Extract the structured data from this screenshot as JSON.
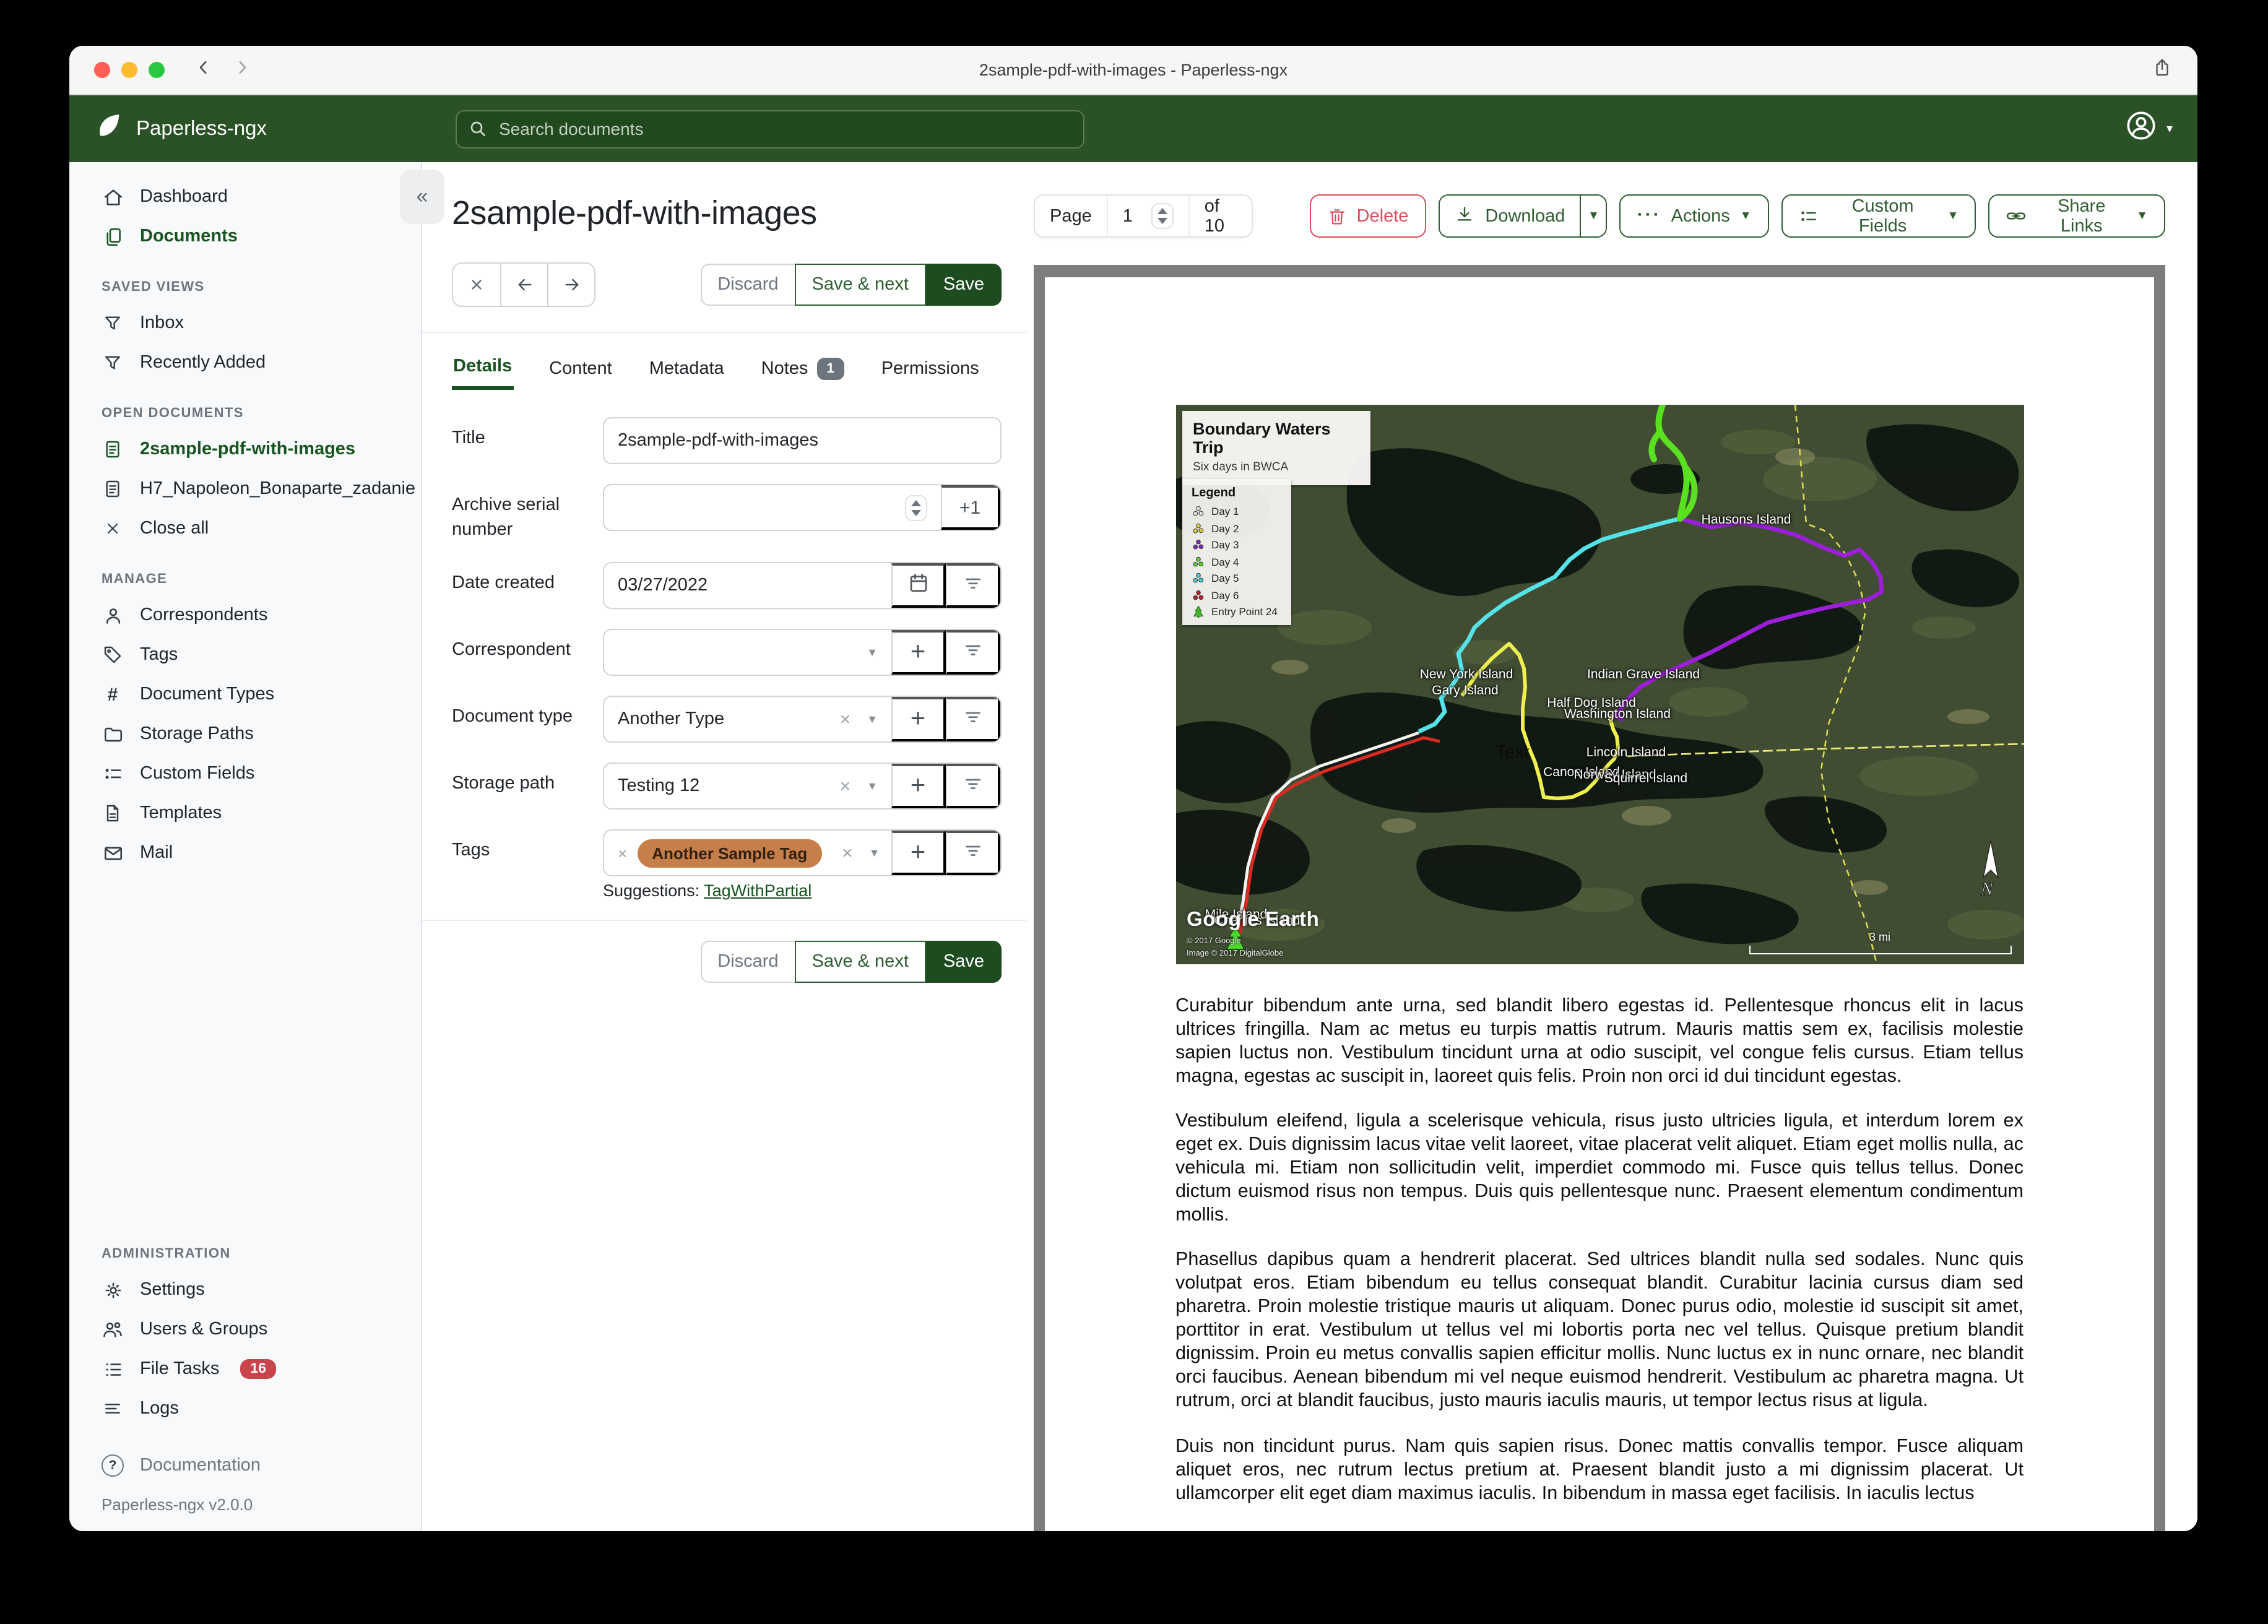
{
  "colors": {
    "header_green": "#2a5226",
    "primary_green": "#2f5e31",
    "active_green": "#17541f",
    "save_green": "#1e4c21",
    "delete_red": "#dc4c5c",
    "badge_red": "#c9444d",
    "tag_orange": "#c67e4a",
    "traffic_red": "#ff5f57",
    "traffic_yellow": "#febc2e",
    "traffic_green": "#28c840"
  },
  "window": {
    "title": "2sample-pdf-with-images - Paperless-ngx"
  },
  "header": {
    "app_name": "Paperless-ngx",
    "search_placeholder": "Search documents"
  },
  "sidebar": {
    "sections": {
      "saved_views": "SAVED VIEWS",
      "open_documents": "OPEN DOCUMENTS",
      "manage": "MANAGE",
      "administration": "ADMINISTRATION"
    },
    "items": {
      "dashboard": "Dashboard",
      "documents": "Documents",
      "inbox": "Inbox",
      "recently_added": "Recently Added",
      "open_doc_1": "2sample-pdf-with-images",
      "open_doc_2": "H7_Napoleon_Bonaparte_zadanie",
      "close_all": "Close all",
      "correspondents": "Correspondents",
      "tags": "Tags",
      "document_types": "Document Types",
      "storage_paths": "Storage Paths",
      "custom_fields": "Custom Fields",
      "templates": "Templates",
      "mail": "Mail",
      "settings": "Settings",
      "users_groups": "Users & Groups",
      "file_tasks": "File Tasks",
      "logs": "Logs",
      "documentation": "Documentation"
    },
    "badges": {
      "file_tasks": "16"
    },
    "version": "Paperless-ngx v2.0.0"
  },
  "detail": {
    "title": "2sample-pdf-with-images",
    "actions": {
      "discard": "Discard",
      "save_next": "Save & next",
      "save": "Save"
    },
    "tabs": {
      "details": "Details",
      "content": "Content",
      "metadata": "Metadata",
      "notes": "Notes",
      "notes_badge": "1",
      "permissions": "Permissions"
    },
    "form": {
      "title_label": "Title",
      "title_value": "2sample-pdf-with-images",
      "asn_label": "Archive serial number",
      "asn_value": "",
      "asn_increment": "+1",
      "date_label": "Date created",
      "date_value": "03/27/2022",
      "correspondent_label": "Correspondent",
      "doctype_label": "Document type",
      "doctype_value": "Another Type",
      "storage_label": "Storage path",
      "storage_value": "Testing 12",
      "tags_label": "Tags",
      "tag_chip": "Another Sample Tag",
      "suggestions_label": "Suggestions:",
      "suggestion_link": "TagWithPartial"
    }
  },
  "preview": {
    "pager": {
      "page_label": "Page",
      "page_value": "1",
      "of_label": "of 10"
    },
    "buttons": {
      "delete": "Delete",
      "download": "Download",
      "actions": "Actions",
      "custom_fields": "Custom Fields",
      "share_links": "Share Links"
    },
    "document": {
      "map": {
        "title": "Boundary Waters Trip",
        "subtitle": "Six days in BWCA",
        "legend_title": "Legend",
        "legend": [
          {
            "label": "Day 1",
            "color": "#dde2e4"
          },
          {
            "label": "Day 2",
            "color": "#d8d43c"
          },
          {
            "label": "Day 3",
            "color": "#7d2ab8"
          },
          {
            "label": "Day 4",
            "color": "#5ecf2e"
          },
          {
            "label": "Day 5",
            "color": "#49ccd6"
          },
          {
            "label": "Day 6",
            "color": "#bf1f26"
          },
          {
            "label": "Entry Point 24",
            "color": "#45b32a"
          }
        ],
        "labels": [
          {
            "text": "Hausons Island"
          },
          {
            "text": "New York Island"
          },
          {
            "text": "Gary Island"
          },
          {
            "text": "Indian Grave Island"
          },
          {
            "text": "Half Dog Island"
          },
          {
            "text": "Washington Island"
          },
          {
            "text": "Lincoln Island"
          },
          {
            "text": "Canoe Island"
          },
          {
            "text": "Norway Island"
          },
          {
            "text": "Squirrel Island"
          },
          {
            "text": "Mile Island"
          },
          {
            "text": "Charlies Island"
          },
          {
            "text": "Text"
          }
        ],
        "attribution": {
          "brand": "Google Earth",
          "copyright": "© 2017 Google",
          "imagery": "Image © 2017 DigitalGlobe"
        },
        "scale_label": "3 mi",
        "north_label": "N"
      },
      "paragraphs": [
        "Curabitur bibendum ante urna, sed blandit libero egestas id. Pellentesque rhoncus elit in lacus ultrices fringilla. Nam ac metus eu turpis mattis rutrum. Mauris mattis sem ex, facilisis molestie sapien luctus non. Vestibulum tincidunt urna at odio suscipit, vel congue felis cursus. Etiam tellus magna, egestas ac suscipit in, laoreet quis felis. Proin non orci id dui tincidunt egestas.",
        "Vestibulum eleifend, ligula a scelerisque vehicula, risus justo ultricies ligula, et interdum lorem ex eget ex. Duis dignissim lacus vitae velit laoreet, vitae placerat velit aliquet. Etiam eget mollis nulla, ac vehicula mi. Etiam non sollicitudin velit, imperdiet commodo mi. Fusce quis tellus tellus. Donec dictum euismod risus non tempus. Duis quis pellentesque nunc. Praesent elementum condimentum mollis.",
        "Phasellus dapibus quam a hendrerit placerat. Sed ultrices blandit nulla sed sodales. Nunc quis volutpat eros. Etiam bibendum eu tellus consequat blandit. Curabitur lacinia cursus diam sed pharetra. Proin molestie tristique mauris ut aliquam. Donec purus odio, molestie id suscipit sit amet, porttitor in erat. Vestibulum ut tellus vel mi lobortis porta nec vel tellus. Quisque pretium blandit dignissim. Proin eu metus convallis sapien efficitur mollis. Nunc luctus ex in nunc ornare, nec blandit orci faucibus. Aenean bibendum mi vel neque euismod hendrerit. Vestibulum ac pharetra magna. Ut rutrum, orci at blandit faucibus, justo mauris iaculis mauris, ut tempor lectus risus at ligula.",
        "Duis non tincidunt purus. Nam quis sapien risus. Donec mattis convallis tempor. Fusce aliquam aliquet eros, nec rutrum lectus pretium at. Praesent blandit justo a mi dignissim placerat. Ut ullamcorper elit eget diam maximus iaculis. In bibendum in massa eget facilisis. In iaculis lectus"
      ]
    }
  }
}
